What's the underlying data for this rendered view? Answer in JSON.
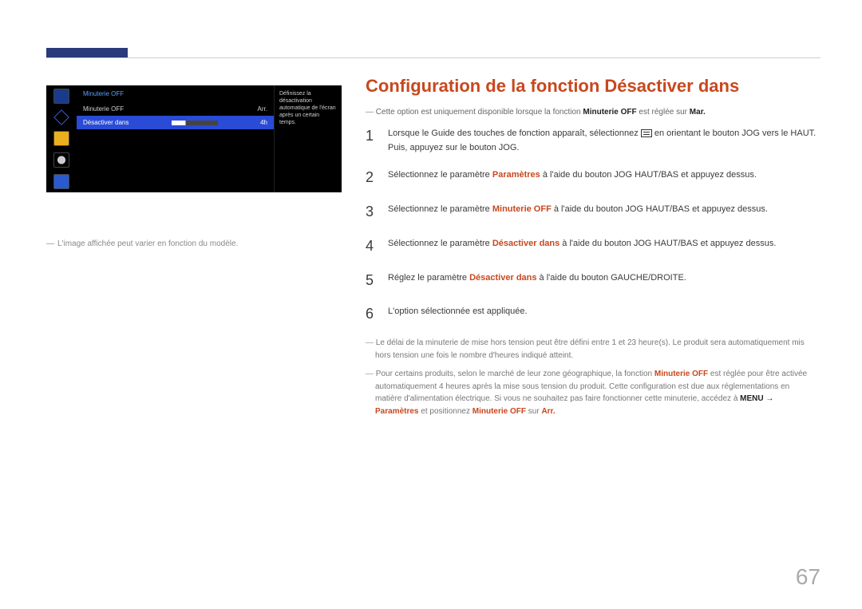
{
  "page_number": "67",
  "osd": {
    "title": "Minuterie OFF",
    "row1_label": "Minuterie OFF",
    "row1_value": "Arr.",
    "row2_label": "Désactiver dans",
    "row2_value": "4h",
    "desc": "Définissez la désactivation automatique de l'écran après un certain temps."
  },
  "osd_caption": "L'image affichée peut varier en fonction du modèle.",
  "content": {
    "title": "Configuration de la fonction Désactiver dans",
    "intro_pre": "Cette option est uniquement disponible lorsque la fonction ",
    "intro_kw1": "Minuterie OFF",
    "intro_mid": " est réglée sur ",
    "intro_kw2": "Mar.",
    "steps": [
      {
        "num": "1",
        "pre": "Lorsque le Guide des touches de fonction apparaît, sélectionnez ",
        "post": " en orientant le bouton JOG vers le HAUT. Puis, appuyez sur le bouton JOG."
      },
      {
        "num": "2",
        "pre": "Sélectionnez le paramètre ",
        "kw": "Paramètres",
        "post": " à l'aide du bouton JOG HAUT/BAS et appuyez dessus."
      },
      {
        "num": "3",
        "pre": "Sélectionnez le paramètre ",
        "kw": "Minuterie OFF",
        "post": " à l'aide du bouton JOG HAUT/BAS et appuyez dessus."
      },
      {
        "num": "4",
        "pre": "Sélectionnez le paramètre ",
        "kw": "Désactiver dans",
        "post": " à l'aide du bouton JOG HAUT/BAS et appuyez dessus."
      },
      {
        "num": "5",
        "pre": "Réglez le paramètre ",
        "kw": "Désactiver dans",
        "post": " à l'aide du bouton GAUCHE/DROITE."
      },
      {
        "num": "6",
        "pre": "L'option sélectionnée est appliquée."
      }
    ],
    "footnote1": "Le délai de la minuterie de mise hors tension peut être défini entre 1 et 23 heure(s). Le produit sera automatiquement mis hors tension une fois le nombre d'heures indiqué atteint.",
    "footnote2_pre": "Pour certains produits, selon le marché de leur zone géographique, la fonction ",
    "footnote2_kw1": "Minuterie OFF",
    "footnote2_mid": " est réglée pour être activée automatiquement 4 heures après la mise sous tension du produit. Cette configuration est due aux réglementations en matière d'alimentation électrique. Si vous ne souhaitez pas faire fonctionner cette minuterie, accédez à ",
    "footnote2_menu": "MENU",
    "footnote2_arrow": " → ",
    "footnote2_last_pre": "Paramètres",
    "footnote2_last_mid": " et positionnez ",
    "footnote2_last_kw": "Minuterie OFF",
    "footnote2_last_sur": " sur ",
    "footnote2_last_val": "Arr."
  }
}
